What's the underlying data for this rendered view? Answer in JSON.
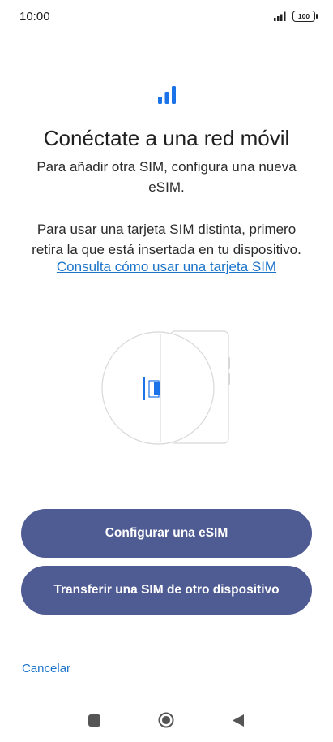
{
  "status_bar": {
    "time": "10:00",
    "battery": "100",
    "icons": [
      "signal-icon",
      "battery-icon"
    ]
  },
  "header": {
    "icon": "cell-signal-icon",
    "title": "Conéctate a una red móvil",
    "subtitle": "Para añadir otra SIM, configura una nueva eSIM."
  },
  "body": {
    "text": "Para usar una tarjeta SIM distinta, primero retira la que está insertada en tu dispositivo.",
    "link": "Consulta cómo usar una tarjeta SIM"
  },
  "illustration": {
    "name": "sim-tray-illustration",
    "accent": "#1a73e8"
  },
  "actions": {
    "configure_esim": "Configurar una eSIM",
    "transfer_sim": "Transferir una SIM de otro dispositivo",
    "cancel": "Cancelar"
  },
  "nav": {
    "icons": [
      "recents-icon",
      "home-icon",
      "back-icon"
    ]
  },
  "colors": {
    "primary_button": "#4f5b93",
    "link": "#1a73c9",
    "accent": "#1a73e8"
  }
}
